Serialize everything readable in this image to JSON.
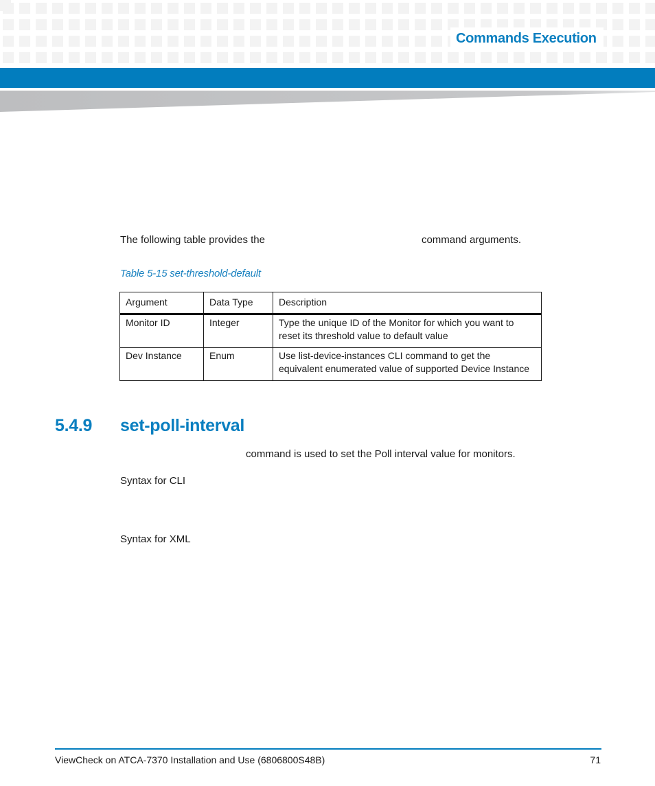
{
  "header": {
    "chapter_title": "Commands Execution",
    "colors": {
      "accent_blue": "#027dbe",
      "title_blue": "#0a7fc0",
      "grid_gray": "#f3f3f3",
      "wedge_gray": "#bdbec0"
    }
  },
  "intro": {
    "text_before": "The following table provides the",
    "text_after": "command arguments."
  },
  "table": {
    "caption": "Table 5-15 set-threshold-default",
    "columns": [
      "Argument",
      "Data Type",
      "Description"
    ],
    "rows": [
      {
        "argument": "Monitor ID",
        "data_type": "Integer",
        "description": "Type the unique ID of the Monitor for which you want to reset its threshold value to default value"
      },
      {
        "argument": "Dev Instance",
        "data_type": "Enum",
        "description": "Use list-device-instances CLI command to get the equivalent enumerated value of supported Device Instance"
      }
    ]
  },
  "section": {
    "number": "5.4.9",
    "title": "set-poll-interval",
    "description": "command is used to set the Poll interval value for monitors.",
    "syntax_cli_label": "Syntax for CLI",
    "syntax_xml_label": "Syntax for XML"
  },
  "footer": {
    "document_title": "ViewCheck on ATCA-7370 Installation and Use (6806800S48B)",
    "page_number": "71"
  }
}
